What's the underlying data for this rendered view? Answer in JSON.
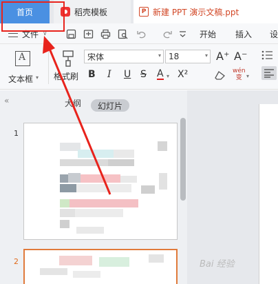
{
  "tabs": {
    "home": "首页",
    "template": "稻壳模板",
    "document": "新建 PPT 演示文稿.ppt"
  },
  "menu": {
    "file": "文件",
    "start": "开始",
    "insert": "插入",
    "more": "设"
  },
  "ribbon": {
    "textbox": "文本框",
    "format_painter": "格式刷",
    "font": "宋体",
    "font_size": "18",
    "bold": "B",
    "italic": "I",
    "underline": "U",
    "strike": "S",
    "font_color": "A",
    "superscript": "X²",
    "grow_font": "A⁺",
    "shrink_font": "A⁻",
    "phonetic": "wén\n变"
  },
  "panel": {
    "outline": "大纲",
    "slides": "幻灯片",
    "slide_1": "1",
    "slide_2": "2"
  },
  "watermark": "Bai 经验",
  "colors": {
    "accent": "#4a90e2",
    "annotation": "#e8231c",
    "doc_tab": "#d24726",
    "selected_slide": "#e07a3a"
  }
}
